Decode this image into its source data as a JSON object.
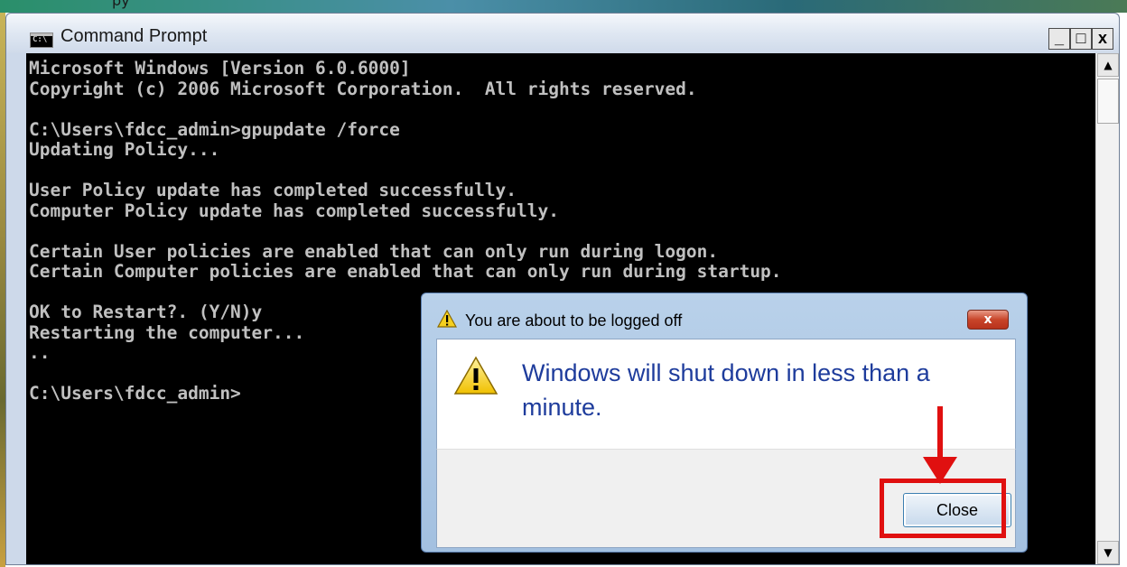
{
  "background": {
    "top_text": "py"
  },
  "window": {
    "title": "Command Prompt",
    "icon_text": "C:\\",
    "buttons": {
      "minimize": "_",
      "maximize": "□",
      "close": "x"
    },
    "colors": {
      "console_bg": "#000000",
      "console_fg": "#c0c0c0"
    }
  },
  "console": {
    "lines": [
      "Microsoft Windows [Version 6.0.6000]",
      "Copyright (c) 2006 Microsoft Corporation.  All rights reserved.",
      "",
      "C:\\Users\\fdcc_admin>gpupdate /force",
      "Updating Policy...",
      "",
      "User Policy update has completed successfully.",
      "Computer Policy update has completed successfully.",
      "",
      "Certain User policies are enabled that can only run during logon.",
      "Certain Computer policies are enabled that can only run during startup.",
      "",
      "OK to Restart?. (Y/N)y",
      "Restarting the computer...",
      "..",
      "",
      "C:\\Users\\fdcc_admin>"
    ]
  },
  "scrollbar": {
    "up_arrow": "▲",
    "down_arrow": "▼"
  },
  "dialog": {
    "title": "You are about to be logged off",
    "message": "Windows will shut down in less than a minute.",
    "close_button_label": "Close",
    "title_close_glyph": "x",
    "warning_icon": "warning-icon",
    "colors": {
      "message": "#1e3c9c",
      "highlight": "#e01010"
    }
  }
}
